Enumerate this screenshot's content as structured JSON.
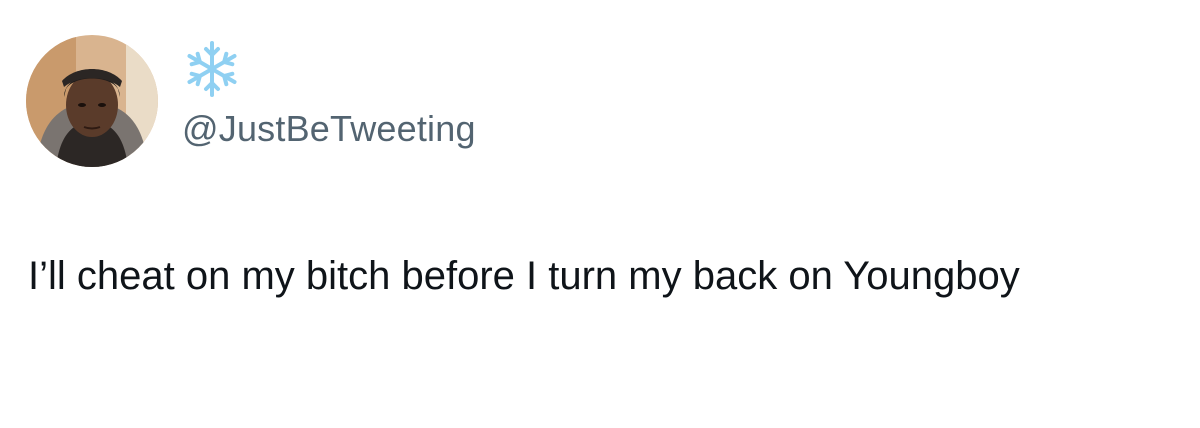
{
  "tweet": {
    "display_name": "❄️",
    "display_name_icon": "snowflake-icon",
    "handle": "@JustBeTweeting",
    "text": "I’ll cheat on my bitch before I turn my back on Youngboy"
  },
  "colors": {
    "background": "#ffffff",
    "text": "#0f1419",
    "handle": "#536471",
    "snowflake": "#8fd0f2"
  }
}
